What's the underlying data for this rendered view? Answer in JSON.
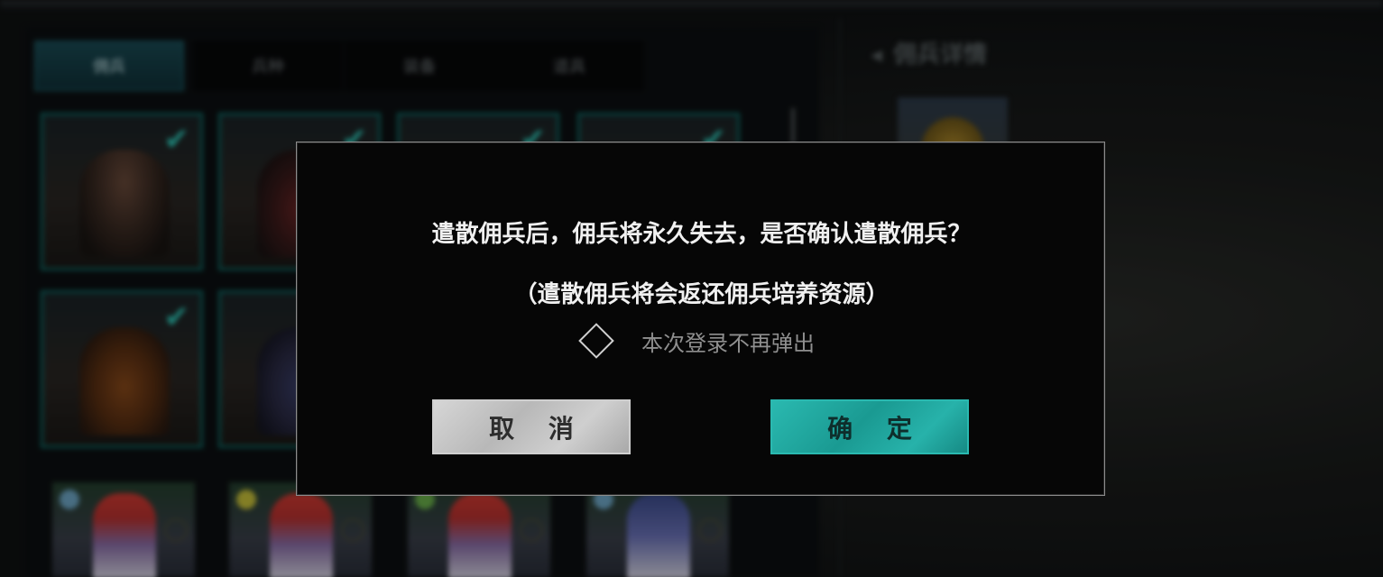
{
  "dialog": {
    "message_line1": "遣散佣兵后，佣兵将永久失去，是否确认遣散佣兵？",
    "message_line2": "（遣散佣兵将会返还佣兵培养资源）",
    "checkbox_label": "本次登录不再弹出",
    "cancel_label": "取 消",
    "confirm_label": "确 定"
  },
  "background": {
    "tabs": [
      {
        "label": "佣兵"
      },
      {
        "label": "兵种"
      },
      {
        "label": "装备"
      },
      {
        "label": "道具"
      }
    ],
    "right_title": "佣兵详情"
  },
  "colors": {
    "accent": "#2ab9b0",
    "dialog_bg": "#060606"
  },
  "icons": {
    "checkbox": "diamond-checkbox-icon",
    "selected": "checkmark-icon",
    "back": "arrow-left-icon"
  }
}
